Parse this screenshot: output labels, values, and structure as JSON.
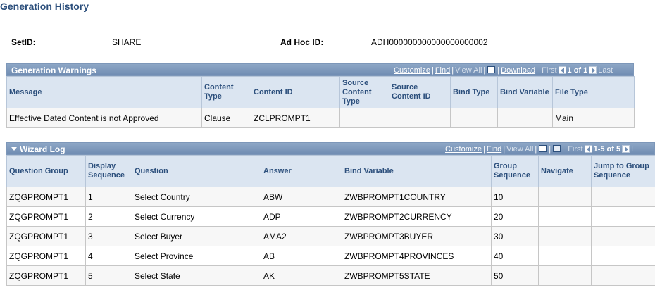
{
  "page": {
    "title": "Generation History"
  },
  "header": {
    "setid_label": "SetID:",
    "setid_value": "SHARE",
    "adhoc_label": "Ad Hoc ID:",
    "adhoc_value": "ADH000000000000000000002"
  },
  "warnings": {
    "title": "Generation Warnings",
    "nav": {
      "customize": "Customize",
      "find": "Find",
      "view_all": "View All",
      "download": "Download",
      "first": "First",
      "count": "1 of 1",
      "last": "Last"
    },
    "columns": [
      "Message",
      "Content Type",
      "Content ID",
      "Source Content Type",
      "Source Content ID",
      "Bind Type",
      "Bind Variable",
      "File Type"
    ],
    "rows": [
      [
        "Effective Dated Content is not Approved",
        "Clause",
        "ZCLPROMPT1",
        "",
        "",
        "",
        "",
        "Main"
      ]
    ]
  },
  "wizard": {
    "title": "Wizard Log",
    "nav": {
      "customize": "Customize",
      "find": "Find",
      "view_all": "View All",
      "first": "First",
      "count": "1-5 of 5",
      "last": "L"
    },
    "columns": [
      "Question Group",
      "Display Sequence",
      "Question",
      "Answer",
      "Bind Variable",
      "Group Sequence",
      "Navigate",
      "Jump to Group Sequence"
    ],
    "rows": [
      [
        "ZQGPROMPT1",
        "1",
        "Select Country",
        "ABW",
        "ZWBPROMPT1COUNTRY",
        "10",
        "",
        ""
      ],
      [
        "ZQGPROMPT1",
        "2",
        "Select Currency",
        "ADP",
        "ZWBPROMPT2CURRENCY",
        "20",
        "",
        ""
      ],
      [
        "ZQGPROMPT1",
        "3",
        "Select Buyer",
        "AMA2",
        "ZWBPROMPT3BUYER",
        "30",
        "",
        ""
      ],
      [
        "ZQGPROMPT1",
        "4",
        "Select Province",
        "AB",
        "ZWBPROMPT4PROVINCES",
        "40",
        "",
        ""
      ],
      [
        "ZQGPROMPT1",
        "5",
        "Select State",
        "AK",
        "ZWBPROMPT5STATE",
        "50",
        "",
        ""
      ]
    ]
  },
  "colors": {
    "title_blue": "#2c4f7c",
    "grid_header": "#dbe5f1",
    "grid_bar": "#6f8cb2"
  }
}
